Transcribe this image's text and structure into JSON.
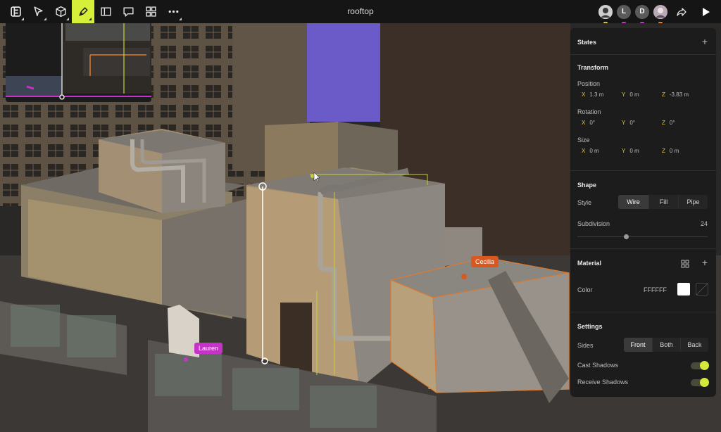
{
  "document": {
    "title": "rooftop"
  },
  "toolbar": {
    "tools": [
      {
        "name": "logo-menu"
      },
      {
        "name": "select-tool"
      },
      {
        "name": "cube-tool"
      },
      {
        "name": "pen-tool",
        "active": true
      },
      {
        "name": "frame-tool"
      },
      {
        "name": "comment-tool"
      },
      {
        "name": "grid-tool"
      },
      {
        "name": "more-tool"
      }
    ],
    "collaborators": [
      {
        "initial": "",
        "color": "#9a9a9a",
        "dot": "#d6c02a"
      },
      {
        "initial": "L",
        "color": "#5a5a5a",
        "dot": "#c535c9"
      },
      {
        "initial": "D",
        "color": "#5a5a5a",
        "dot": "#c535c9"
      },
      {
        "initial": "",
        "color": "#8a7a8a",
        "dot": "#e07a2c"
      }
    ]
  },
  "scene": {
    "labels": [
      {
        "text": "Cecilia",
        "color": "#d8581f"
      },
      {
        "text": "Lauren",
        "color": "#c634c7"
      }
    ]
  },
  "panel": {
    "states": {
      "title": "States"
    },
    "transform": {
      "title": "Transform",
      "position": {
        "label": "Position",
        "x": "1.3 m",
        "y": "0 m",
        "z": "-3.83 m"
      },
      "rotation": {
        "label": "Rotation",
        "x": "0°",
        "y": "0°",
        "z": "0°"
      },
      "size": {
        "label": "Size",
        "x": "0 m",
        "y": "0 m",
        "z": "0 m"
      },
      "axis_labels": [
        "X",
        "Y",
        "Z"
      ]
    },
    "shape": {
      "title": "Shape",
      "style_label": "Style",
      "styles": [
        "Wire",
        "Fill",
        "Pipe"
      ],
      "selected_style": "Wire",
      "subdivision_label": "Subdivision",
      "subdivision_value": "24"
    },
    "material": {
      "title": "Material",
      "color_label": "Color",
      "color_value": "FFFFFF"
    },
    "settings": {
      "title": "Settings",
      "sides_label": "Sides",
      "sides": [
        "Front",
        "Both",
        "Back"
      ],
      "selected_side": "Front",
      "cast_shadows_label": "Cast Shadows",
      "receive_shadows_label": "Receive Shadows",
      "cast_shadows": true,
      "receive_shadows": true
    }
  },
  "colors": {
    "accent": "#d6f03a",
    "toggle": "#d3e83a",
    "axis": "#e3c53d",
    "selection": "#e07a2c"
  }
}
